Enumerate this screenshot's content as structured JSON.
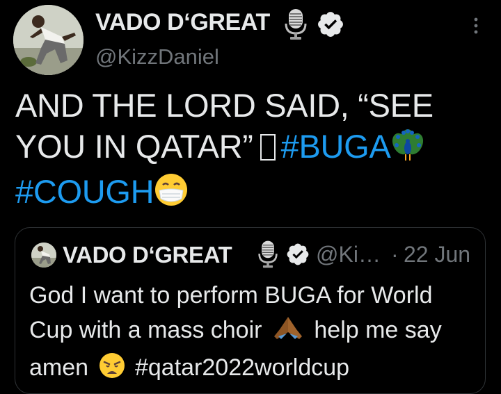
{
  "tweet": {
    "author": {
      "display_name": "VADO D‘GREAT",
      "handle": "@KizzDaniel",
      "badges": [
        "microphone-icon",
        "verified-badge-icon"
      ]
    },
    "text": {
      "line1": "AND THE LORD SAID, “SEE",
      "line2_prefix": "YOU IN QATAR”",
      "line2_hashtag": "#BUGA",
      "line3_hashtag": "#COUGH"
    },
    "menu_icon": "more-options-icon",
    "inline_emojis": [
      "unrenderable-box-glyph",
      "peacock-emoji",
      "face-with-mask-emoji"
    ]
  },
  "quoted_tweet": {
    "author": {
      "display_name": "VADO D‘GREAT",
      "handle": "@Ki…",
      "badges": [
        "microphone-icon",
        "verified-badge-icon"
      ]
    },
    "separator": "·",
    "date": "22 Jun",
    "text": {
      "line1": "God I want to perform BUGA for World",
      "line2_prefix": "Cup with a mass choir",
      "line2_suffix": "help me say",
      "line3_prefix": "amen",
      "line3_hashtag": "#qatar2022worldcup"
    },
    "inline_emojis": [
      "folded-hands-emoji",
      "weary-face-emoji"
    ]
  },
  "colors": {
    "background": "#000000",
    "text": "#e7e9ea",
    "secondary_text": "#71767b",
    "link": "#1d9bf0",
    "border": "#2f3336"
  }
}
